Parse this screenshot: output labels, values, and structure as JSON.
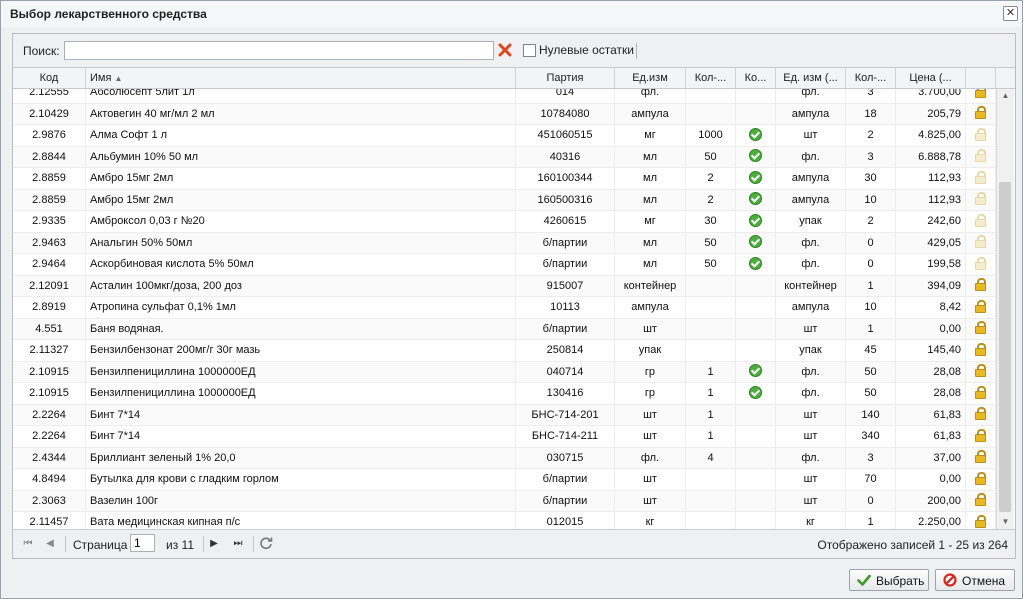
{
  "window": {
    "title": "Выбор лекарственного средства",
    "close_glyph": "✕"
  },
  "toolbar": {
    "search_label": "Поиск:",
    "search_value": "",
    "zero_stock_label": "Нулевые остатки",
    "zero_stock_checked": false
  },
  "columns": [
    "Код",
    "Имя",
    "Партия",
    "Ед.изм",
    "Кол-...",
    "Ко...",
    "Ед. изм (...",
    "Кол-...",
    "Цена (..."
  ],
  "sort": {
    "column": "Имя",
    "direction": "asc",
    "glyph": "▲"
  },
  "rows": [
    {
      "code": "2.12555",
      "name": "Абсолюсепт 5лит 1л",
      "batch": "014",
      "unit": "фл.",
      "qty": "",
      "ok": false,
      "unit2": "фл.",
      "qty2": "3",
      "price": "3.700,00",
      "locked": true
    },
    {
      "code": "2.10429",
      "name": "Актовегин 40 мг/мл 2 мл",
      "batch": "10784080",
      "unit": "ампула",
      "qty": "",
      "ok": false,
      "unit2": "ампула",
      "qty2": "18",
      "price": "205,79",
      "locked": true
    },
    {
      "code": "2.9876",
      "name": "Алма Софт 1 л",
      "batch": "451060515",
      "unit": "мг",
      "qty": "1000",
      "ok": true,
      "unit2": "шт",
      "qty2": "2",
      "price": "4.825,00",
      "locked": false
    },
    {
      "code": "2.8844",
      "name": "Альбумин 10% 50 мл",
      "batch": "40316",
      "unit": "мл",
      "qty": "50",
      "ok": true,
      "unit2": "фл.",
      "qty2": "3",
      "price": "6.888,78",
      "locked": false
    },
    {
      "code": "2.8859",
      "name": "Амбро 15мг 2мл",
      "batch": "160100344",
      "unit": "мл",
      "qty": "2",
      "ok": true,
      "unit2": "ампула",
      "qty2": "30",
      "price": "112,93",
      "locked": false
    },
    {
      "code": "2.8859",
      "name": "Амбро 15мг 2мл",
      "batch": "160500316",
      "unit": "мл",
      "qty": "2",
      "ok": true,
      "unit2": "ампула",
      "qty2": "10",
      "price": "112,93",
      "locked": false
    },
    {
      "code": "2.9335",
      "name": "Амброксол 0,03 г №20",
      "batch": "4260615",
      "unit": "мг",
      "qty": "30",
      "ok": true,
      "unit2": "упак",
      "qty2": "2",
      "price": "242,60",
      "locked": false
    },
    {
      "code": "2.9463",
      "name": "Анальгин 50% 50мл",
      "batch": "б/партии",
      "unit": "мл",
      "qty": "50",
      "ok": true,
      "unit2": "фл.",
      "qty2": "0",
      "price": "429,05",
      "locked": false
    },
    {
      "code": "2.9464",
      "name": "Аскорбиновая кислота 5% 50мл",
      "batch": "б/партии",
      "unit": "мл",
      "qty": "50",
      "ok": true,
      "unit2": "фл.",
      "qty2": "0",
      "price": "199,58",
      "locked": false
    },
    {
      "code": "2.12091",
      "name": "Асталин 100мкг/доза, 200 доз",
      "batch": "915007",
      "unit": "контейнер",
      "qty": "",
      "ok": false,
      "unit2": "контейнер",
      "qty2": "1",
      "price": "394,09",
      "locked": true
    },
    {
      "code": "2.8919",
      "name": "Атропина сульфат 0,1% 1мл",
      "batch": "10113",
      "unit": "ампула",
      "qty": "",
      "ok": false,
      "unit2": "ампула",
      "qty2": "10",
      "price": "8,42",
      "locked": true
    },
    {
      "code": "4.551",
      "name": "Баня водяная.",
      "batch": "б/партии",
      "unit": "шт",
      "qty": "",
      "ok": false,
      "unit2": "шт",
      "qty2": "1",
      "price": "0,00",
      "locked": true
    },
    {
      "code": "2.11327",
      "name": "Бензилбензонат 200мг/г 30г мазь",
      "batch": "250814",
      "unit": "упак",
      "qty": "",
      "ok": false,
      "unit2": "упак",
      "qty2": "45",
      "price": "145,40",
      "locked": true
    },
    {
      "code": "2.10915",
      "name": "Бензилпенициллина 1000000ЕД",
      "batch": "040714",
      "unit": "гр",
      "qty": "1",
      "ok": true,
      "unit2": "фл.",
      "qty2": "50",
      "price": "28,08",
      "locked": true
    },
    {
      "code": "2.10915",
      "name": "Бензилпенициллина 1000000ЕД",
      "batch": "130416",
      "unit": "гр",
      "qty": "1",
      "ok": true,
      "unit2": "фл.",
      "qty2": "50",
      "price": "28,08",
      "locked": true
    },
    {
      "code": "2.2264",
      "name": "Бинт 7*14",
      "batch": "БНС-714-201",
      "unit": "шт",
      "qty": "1",
      "ok": false,
      "unit2": "шт",
      "qty2": "140",
      "price": "61,83",
      "locked": true
    },
    {
      "code": "2.2264",
      "name": "Бинт 7*14",
      "batch": "БНС-714-211",
      "unit": "шт",
      "qty": "1",
      "ok": false,
      "unit2": "шт",
      "qty2": "340",
      "price": "61,83",
      "locked": true
    },
    {
      "code": "2.4344",
      "name": "Бриллиант зеленый 1% 20,0",
      "batch": "030715",
      "unit": "фл.",
      "qty": "4",
      "ok": false,
      "unit2": "фл.",
      "qty2": "3",
      "price": "37,00",
      "locked": true
    },
    {
      "code": "4.8494",
      "name": "Бутылка для крови с гладким горлом",
      "batch": "б/партии",
      "unit": "шт",
      "qty": "",
      "ok": false,
      "unit2": "шт",
      "qty2": "70",
      "price": "0,00",
      "locked": true
    },
    {
      "code": "2.3063",
      "name": "Вазелин 100г",
      "batch": "б/партии",
      "unit": "шт",
      "qty": "",
      "ok": false,
      "unit2": "шт",
      "qty2": "0",
      "price": "200,00",
      "locked": true
    },
    {
      "code": "2.11457",
      "name": "Вата медицинская кипная п/с",
      "batch": "012015",
      "unit": "кг",
      "qty": "",
      "ok": false,
      "unit2": "кг",
      "qty2": "1",
      "price": "2.250,00",
      "locked": true
    }
  ],
  "pager": {
    "page_label": "Страница",
    "page_value": "1",
    "of_label": "из 11",
    "records_text": "Отображено записей 1 - 25 из 264"
  },
  "buttons": {
    "select_label": "Выбрать",
    "cancel_label": "Отмена"
  },
  "colors": {
    "check_green": "#4cae3c",
    "clear_red": "#e0461c",
    "lock_gold": "#e8b923",
    "cancel_red": "#d02b20"
  },
  "icons": {
    "ok": "check-circle-icon",
    "locked": "lock-icon",
    "clear": "clear-x-icon",
    "refresh": "refresh-icon"
  }
}
